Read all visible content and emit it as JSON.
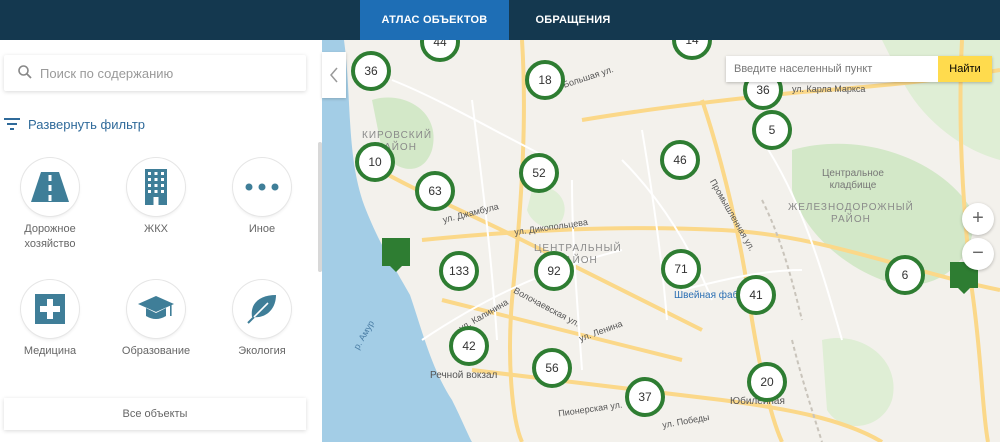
{
  "header": {
    "tabs": [
      {
        "label": "АТЛАС ОБЪЕКТОВ",
        "active": true
      },
      {
        "label": "ОБРАЩЕНИЯ",
        "active": false
      }
    ]
  },
  "sidebar": {
    "search": {
      "placeholder": "Поиск по содержанию",
      "icon": "search-icon"
    },
    "filter_label": "Развернуть фильтр",
    "categories": [
      {
        "label": "Дорожное\nхозяйство",
        "icon": "road-icon"
      },
      {
        "label": "ЖКХ",
        "icon": "building-icon"
      },
      {
        "label": "Иное",
        "icon": "dots-icon"
      },
      {
        "label": "Медицина",
        "icon": "medical-cross-icon"
      },
      {
        "label": "Образование",
        "icon": "graduation-cap-icon"
      },
      {
        "label": "Экология",
        "icon": "leaf-icon"
      }
    ],
    "all_objects": "Все объекты"
  },
  "map": {
    "city_search": {
      "placeholder": "Введите населенный пункт",
      "button": "Найти"
    },
    "zoom_in": "+",
    "zoom_out": "−",
    "clusters": [
      "44",
      "14",
      "36",
      "18",
      "36",
      "5",
      "10",
      "52",
      "46",
      "63",
      "133",
      "92",
      "71",
      "41",
      "6",
      "42",
      "56",
      "37",
      "20"
    ],
    "districts": [
      "КИРОВСКИЙ\nРАЙОН",
      "ЦЕНТРАЛЬНЫЙ\nРАЙОН",
      "ЖЕЛЕЗНОДОРОЖНЫЙ\nРАЙОН"
    ],
    "places": [
      "Центральное\nкладбище",
      "Швейная фабрика",
      "Речной вокзал",
      "Юбилейная"
    ],
    "streets": [
      "Большая ул.",
      "ул. Карла Маркса",
      "ул. Дикопольцева",
      "ул. Джамбула",
      "ул. Ленина",
      "ул. Калинина",
      "Волочаевская ул.",
      "Пионерская ул.",
      "ул. Победы",
      "Промышленная ул.",
      "р. Амур"
    ],
    "colors": {
      "cluster": "#2e7d32",
      "header": "#14384f",
      "active_tab": "#1e6eb5",
      "search_button": "#ffdb4d",
      "accent_text": "#2f6a9a"
    }
  }
}
